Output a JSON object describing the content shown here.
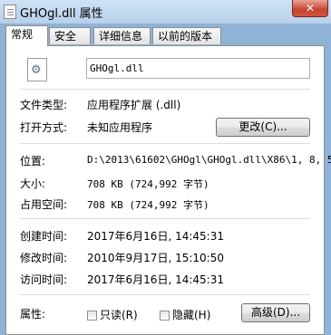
{
  "window": {
    "title": "GHOgl.dll 属性",
    "close_label": "✕"
  },
  "tabs": [
    {
      "label": "常规"
    },
    {
      "label": "安全"
    },
    {
      "label": "详细信息"
    },
    {
      "label": "以前的版本"
    }
  ],
  "file": {
    "name": "GHOgl.dll"
  },
  "labels": {
    "file_type": "文件类型:",
    "open_with": "打开方式:",
    "location": "位置:",
    "size": "大小:",
    "size_on_disk": "占用空间:",
    "created": "创建时间:",
    "modified": "修改时间:",
    "accessed": "访问时间:",
    "attributes": "属性:"
  },
  "values": {
    "file_type": "应用程序扩展 (.dll)",
    "open_with": "未知应用程序",
    "location": "D:\\2013\\61602\\GHOgl\\GHOgl.dll\\X86\\1, 8, 5",
    "size": "708 KB (724,992 字节)",
    "size_on_disk": "708 KB (724,992 字节)",
    "created": "2017年6月16日, 14:45:31",
    "modified": "2010年9月17日, 15:10:50",
    "accessed": "2017年6月16日, 14:45:31"
  },
  "buttons": {
    "change": "更改(C)...",
    "advanced": "高级(D)..."
  },
  "attributes": {
    "readonly": {
      "label": "只读(R)",
      "checked": false
    },
    "hidden": {
      "label": "隐藏(H)",
      "checked": false
    }
  }
}
